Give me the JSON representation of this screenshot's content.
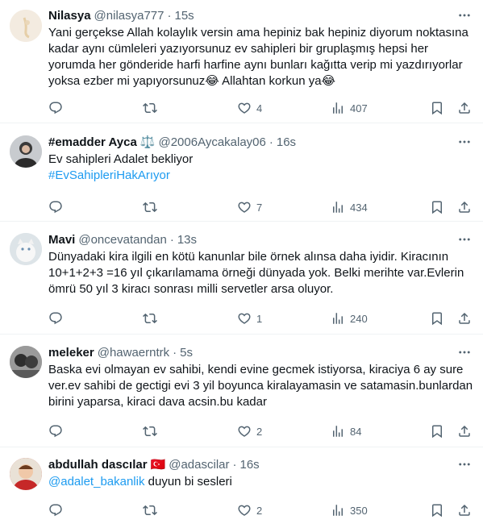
{
  "tweets": [
    {
      "name": "Nilasya",
      "handle": "@nilasya777",
      "time": "15s",
      "text_parts": [
        "Yani gerçekse Allah kolaylık versin ama hepiniz bak hepiniz diyorum noktasına kadar aynı cümleleri yazıyorsunuz ev sahipleri bir gruplaşmış hepsi her yorumda her gönderide harfi harfine aynı bunları kağıtta verip mi yazdırıyorlar yoksa ezber mi yapıyorsunuz",
        "😂",
        " Allahtan korkun ya",
        "😂"
      ],
      "stats": {
        "replies": "",
        "retweets": "",
        "likes": "4",
        "views": "407"
      }
    },
    {
      "name": "#emadder Ayca",
      "badge": "⚖️",
      "handle": "@2006Aycakalay06",
      "time": "16s",
      "text": "Ev sahipleri Adalet bekliyor",
      "hashtag": "#EvSahipleriHakArıyor",
      "stats": {
        "replies": "",
        "retweets": "",
        "likes": "7",
        "views": "434"
      }
    },
    {
      "name": "Mavi",
      "handle": "@oncevatandan",
      "time": "13s",
      "text": "Dünyadaki kira ilgili en kötü kanunlar bile örnek alınsa daha iyidir. Kiracının 10+1+2+3 =16 yıl çıkarılamama örneği dünyada yok. Belki merihte var.Evlerin ömrü 50 yıl 3 kiracı sonrası milli servetler arsa oluyor.",
      "stats": {
        "replies": "",
        "retweets": "",
        "likes": "1",
        "views": "240"
      }
    },
    {
      "name": "meleker",
      "handle": "@hawaerntrk",
      "time": "5s",
      "text": "Baska evi olmayan ev sahibi, kendi evine gecmek istiyorsa, kiraciya 6 ay sure ver.ev sahibi de gectigi evi 3 yil boyunca kiralayamasin ve satamasin.bunlardan birini yaparsa, kiraci dava acsin.bu kadar",
      "stats": {
        "replies": "",
        "retweets": "",
        "likes": "2",
        "views": "84"
      }
    },
    {
      "name": "abdullah dascılar",
      "flag": "🇹🇷",
      "handle": "@adascilar",
      "time": "16s",
      "mention": "@adalet_bakanlik",
      "text": " duyun bi sesleri",
      "stats": {
        "replies": "",
        "retweets": "",
        "likes": "2",
        "views": "350"
      }
    }
  ],
  "icons": {
    "reply": "reply-icon",
    "retweet": "retweet-icon",
    "like": "heart-icon",
    "views": "views-icon",
    "bookmark": "bookmark-icon",
    "share": "share-icon",
    "more": "more-icon"
  },
  "colors": {
    "text": "#0f1419",
    "secondary": "#536471",
    "link": "#1d9bf0",
    "divider": "#eff3f4"
  }
}
